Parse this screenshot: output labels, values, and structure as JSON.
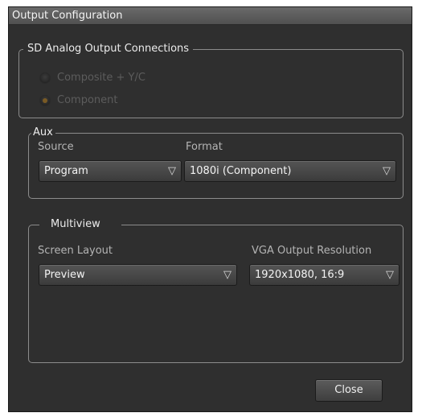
{
  "window": {
    "title": "Output Configuration"
  },
  "sd_analog": {
    "legend": "SD Analog Output Connections",
    "options": [
      {
        "label": "Composite + Y/C",
        "checked": false,
        "enabled": false
      },
      {
        "label": "Component",
        "checked": true,
        "enabled": false
      }
    ]
  },
  "aux": {
    "legend": "Aux",
    "source_label": "Source",
    "source_value": "Program",
    "format_label": "Format",
    "format_value": "1080i (Component)"
  },
  "multiview": {
    "legend": "Multiview",
    "layout_label": "Screen Layout",
    "layout_value": "Preview",
    "vga_label": "VGA Output Resolution",
    "vga_value": "1920x1080,  16:9"
  },
  "footer": {
    "close_label": "Close"
  },
  "icons": {
    "dropdown_arrow": "▽"
  },
  "colors": {
    "window_bg": "#2f2f2f",
    "titlebar": "#5e5e5e",
    "group_border": "#8c8c8c",
    "radio_selected": "#7a5a24"
  }
}
